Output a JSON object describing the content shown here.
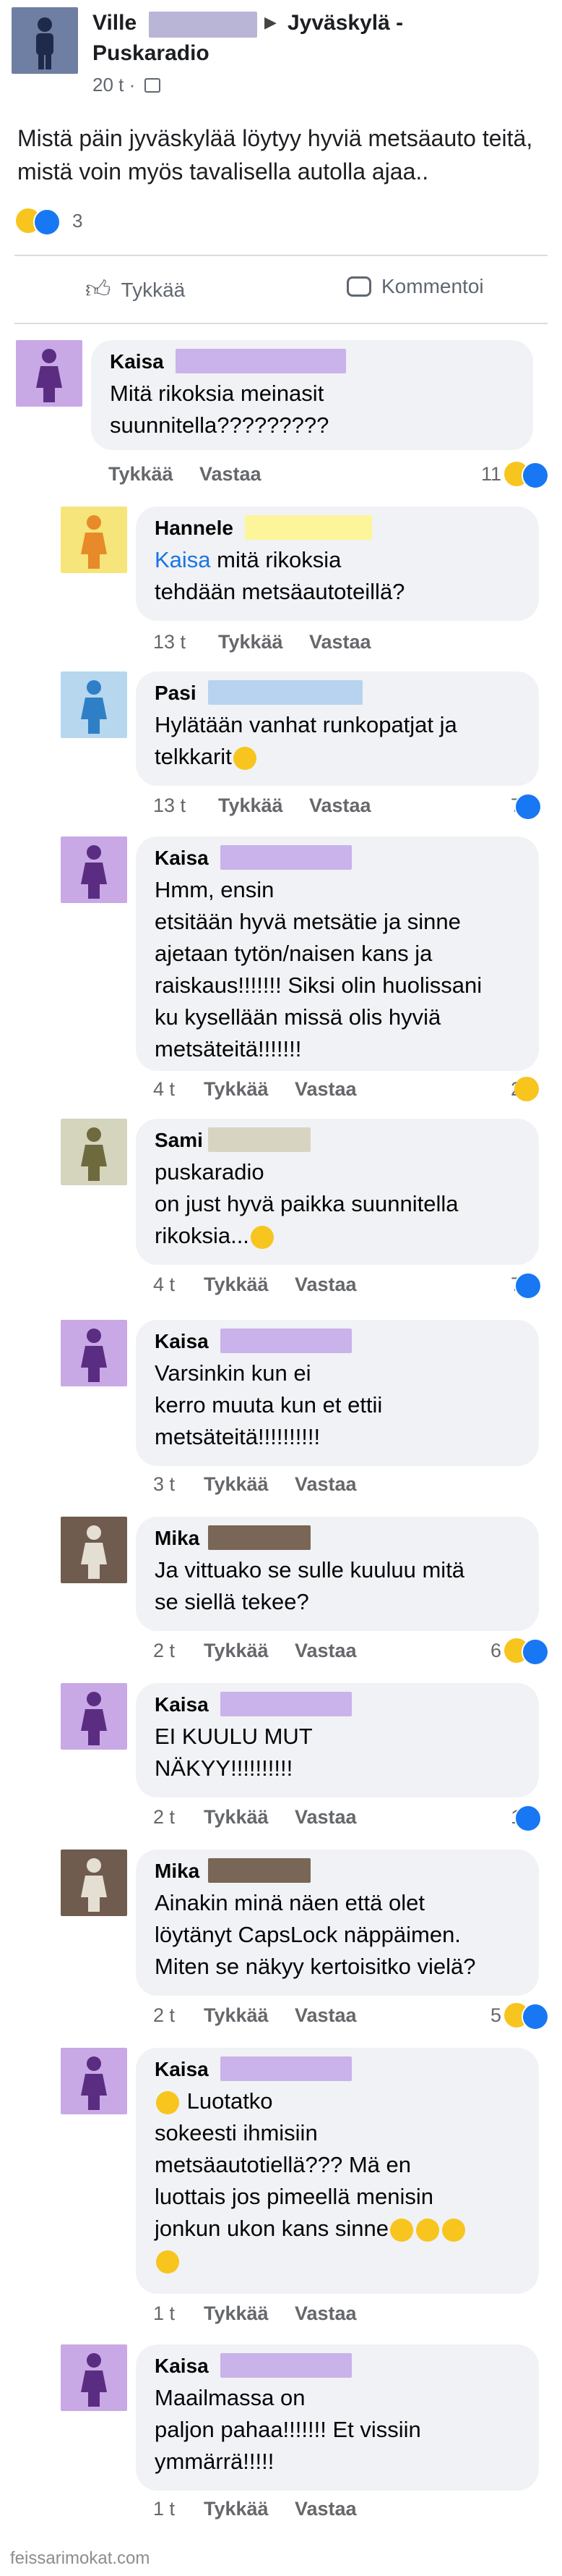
{
  "post": {
    "author_name": "Ville",
    "group_name": "Jyväskylä -",
    "group_name_2": "Puskaradio",
    "time": "20 t ·",
    "text": "Mistä päin jyväskylää löytyy hyviä metsäauto teitä, mistä voin myös tavalisella autolla ajaa..",
    "reaction_count": "3",
    "like_label": "Tykkää",
    "comment_label": "Kommentoi"
  },
  "comments": [
    {
      "name": "Kaisa",
      "text": "Mitä rikoksia meinasit\nsuunnitella?????????",
      "time": "",
      "like": "Tykkää",
      "reply": "Vastaa",
      "count": "11"
    },
    {
      "name": "Hannele",
      "mention": "Kaisa",
      "text": " mitä rikoksia\ntehdään metsäautoteillä?",
      "time": "13 t",
      "like": "Tykkää",
      "reply": "Vastaa",
      "count": ""
    },
    {
      "name": "Pasi",
      "text": "Hylätään vanhat runkopatjat ja\ntelkkarit",
      "time": "13 t",
      "like": "Tykkää",
      "reply": "Vastaa",
      "count": "7"
    },
    {
      "name": "Kaisa",
      "text": "Hmm, ensin\netsitään hyvä metsätie ja sinne\najetaan tytön/naisen kans ja\nraiskaus!!!!!!! Siksi olin huolissani\nku kysellään missä olis hyviä\nmetsäteitä!!!!!!!",
      "time": "4 t",
      "like": "Tykkää",
      "reply": "Vastaa",
      "count": "2"
    },
    {
      "name": "Sami",
      "text": "puskaradio\non just hyvä paikka suunnitella\nrikoksia...",
      "time": "4 t",
      "like": "Tykkää",
      "reply": "Vastaa",
      "count": "7"
    },
    {
      "name": "Kaisa",
      "text": "Varsinkin kun ei\nkerro muuta kun et ettii\nmetsäteitä!!!!!!!!!!",
      "time": "3 t",
      "like": "Tykkää",
      "reply": "Vastaa",
      "count": ""
    },
    {
      "name": "Mika",
      "text": "Ja vittuako se sulle kuuluu mitä\nse siellä tekee?",
      "time": "2 t",
      "like": "Tykkää",
      "reply": "Vastaa",
      "count": "6"
    },
    {
      "name": "Kaisa",
      "text": "EI KUULU MUT\nNÄKYY!!!!!!!!!!",
      "time": "2 t",
      "like": "Tykkää",
      "reply": "Vastaa",
      "count": "1"
    },
    {
      "name": "Mika",
      "text": "Ainakin minä näen että olet\nlöytänyt CapsLock näppäimen.\nMiten se näkyy kertoisitko vielä?",
      "time": "2 t",
      "like": "Tykkää",
      "reply": "Vastaa",
      "count": "5"
    },
    {
      "name": "Kaisa",
      "text": " Luotatko\nsokeesti ihmisiin\nmetsäautotiellä??? Mä en\nluottais jos pimeellä menisin\njonkun ukon kans sinne",
      "time": "1 t",
      "like": "Tykkää",
      "reply": "Vastaa",
      "count": ""
    },
    {
      "name": "Kaisa",
      "text": "Maailmassa on\npaljon pahaa!!!!!!! Et vissiin\nymmärrä!!!!!",
      "time": "1 t",
      "like": "Tykkää",
      "reply": "Vastaa",
      "count": ""
    }
  ],
  "footer": "feissarimokat.com",
  "colors": {
    "like_blue": "#1877f2",
    "haha_yellow": "#f7c51e",
    "mention_blue": "#1b74e4",
    "censor_purple": "#c9b3ea",
    "censor_blue": "#b7d3f0",
    "censor_yellow": "#fdf59a",
    "censor_tan": "#d8d4c2",
    "censor_brown": "#7a6656"
  }
}
